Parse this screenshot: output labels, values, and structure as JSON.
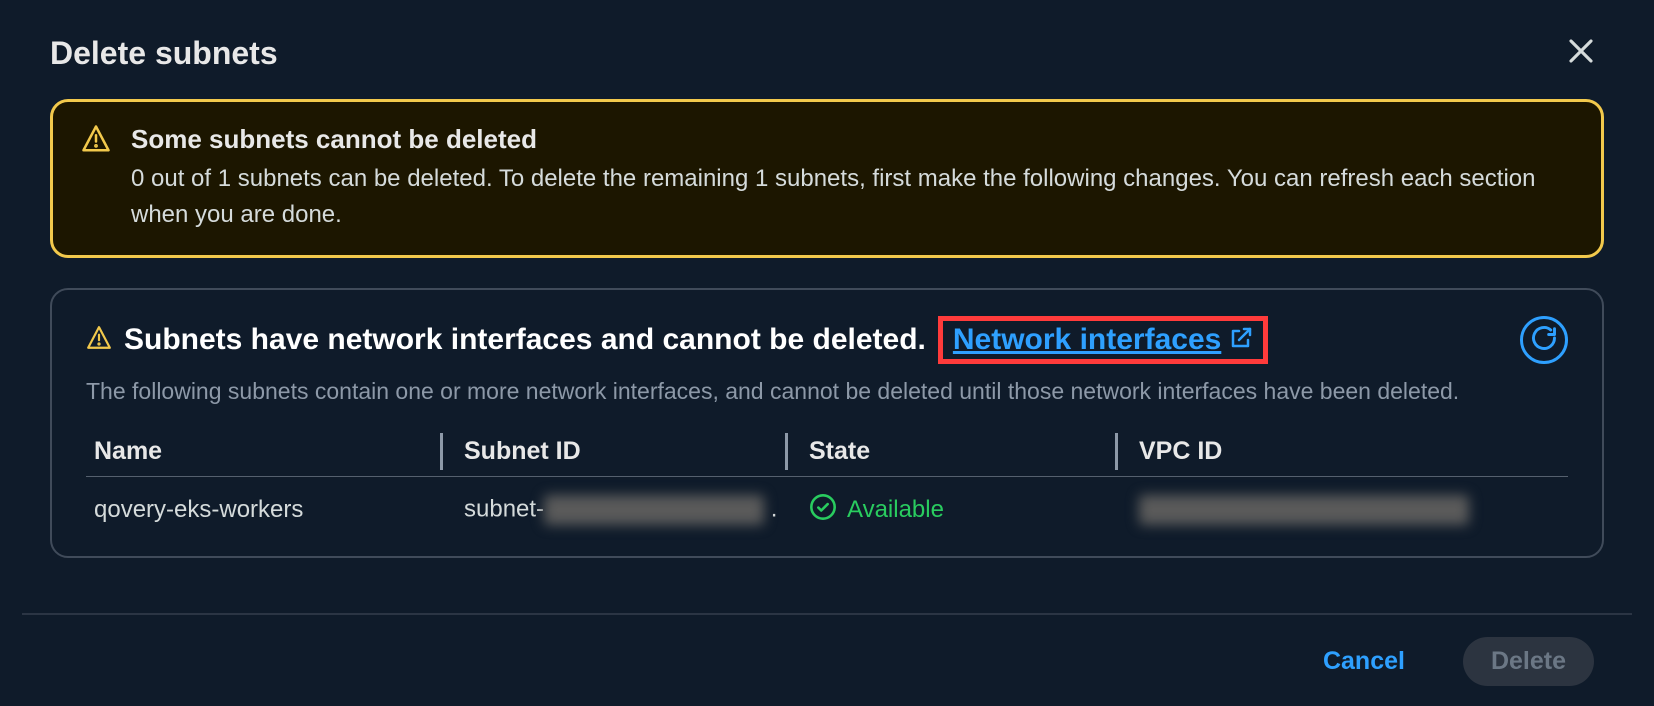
{
  "dialog": {
    "title": "Delete subnets"
  },
  "alert": {
    "title": "Some subnets cannot be deleted",
    "text": "0 out of 1 subnets can be deleted. To delete the remaining 1 subnets, first make the following changes. You can refresh each section when you are done."
  },
  "section": {
    "title": "Subnets have network interfaces and cannot be deleted.",
    "link": "Network interfaces",
    "description": "The following subnets contain one or more network interfaces, and cannot be deleted until those network interfaces have been deleted."
  },
  "table": {
    "headers": {
      "name": "Name",
      "subnet_id": "Subnet ID",
      "state": "State",
      "vpc_id": "VPC ID"
    },
    "rows": [
      {
        "name": "qovery-eks-workers",
        "subnet_prefix": "subnet-",
        "state": "Available"
      }
    ]
  },
  "footer": {
    "cancel": "Cancel",
    "delete": "Delete"
  }
}
